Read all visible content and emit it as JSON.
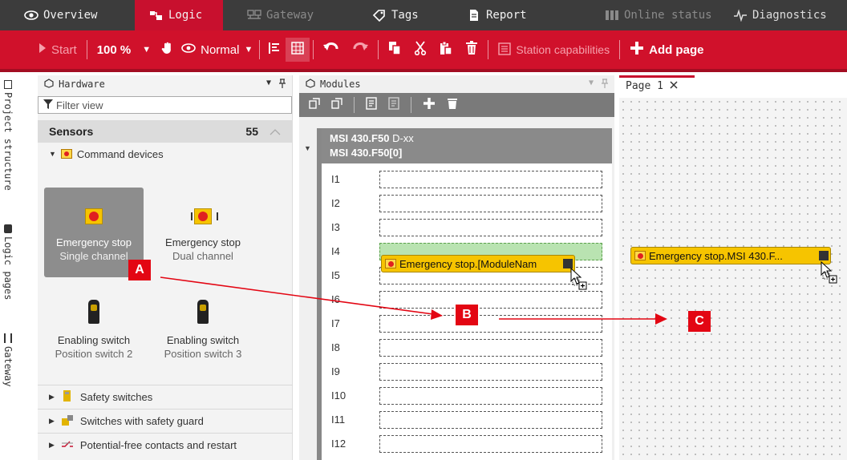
{
  "tabs": [
    {
      "label": "Overview",
      "icon": "eye-icon"
    },
    {
      "label": "Logic",
      "icon": "logic-icon"
    },
    {
      "label": "Gateway",
      "icon": "gateway-icon"
    },
    {
      "label": "Tags",
      "icon": "tag-icon"
    },
    {
      "label": "Report",
      "icon": "document-icon"
    },
    {
      "label": "Online status",
      "icon": "online-status-icon"
    },
    {
      "label": "Diagnostics",
      "icon": "pulse-icon"
    }
  ],
  "active_tab": "Logic",
  "toolbar": {
    "start": "Start",
    "zoom": "100 %",
    "mode": "Normal",
    "station_capabilities": "Station capabilities",
    "add_page": "Add page"
  },
  "vsidebar": [
    {
      "label": "Project structure",
      "icon": "project-icon"
    },
    {
      "label": "Logic pages",
      "icon": "logic-pages-icon"
    },
    {
      "label": "Gateway",
      "icon": "gateway-icon"
    }
  ],
  "hardware": {
    "title": "Hardware",
    "filter_placeholder": "Filter view",
    "group": {
      "label": "Sensors",
      "count": "55"
    },
    "subgroup": "Command devices",
    "tiles": [
      {
        "line1": "Emergency stop",
        "line2": "Single channel",
        "icon": "emergency-stop-icon",
        "selected": true
      },
      {
        "line1": "Emergency stop",
        "line2": "Dual channel",
        "icon": "emergency-stop-dual-icon",
        "selected": false
      },
      {
        "line1": "Enabling switch",
        "line2": "Position switch 2",
        "icon": "enabling-switch-icon",
        "selected": false
      },
      {
        "line1": "Enabling switch",
        "line2": "Position switch 3",
        "icon": "enabling-switch-icon",
        "selected": false
      }
    ],
    "tree": [
      {
        "label": "Safety switches",
        "icon": "safety-switch-icon"
      },
      {
        "label": "Switches with safety guard",
        "icon": "safety-guard-icon"
      },
      {
        "label": "Potential-free contacts and restart",
        "icon": "contact-icon"
      }
    ]
  },
  "modules": {
    "title": "Modules",
    "module_name": "MSI 430.F50",
    "module_suffix": "D-xx",
    "module_id": "MSI 430.F50[0]",
    "inputs": [
      "I1",
      "I2",
      "I3",
      "I4",
      "I5",
      "I6",
      "I7",
      "I8",
      "I9",
      "I10",
      "I11",
      "I12"
    ],
    "chip_label": "Emergency stop.[ModuleNam"
  },
  "page": {
    "tab_label": "Page 1",
    "chip_label": "Emergency stop.MSI 430.F..."
  },
  "annotations": {
    "a": "A",
    "b": "B",
    "c": "C"
  },
  "colors": {
    "brand_red": "#c8102e",
    "toolbar_red": "#d0112b",
    "chip_yellow": "#f6c400",
    "arrow_red": "#e30613"
  }
}
